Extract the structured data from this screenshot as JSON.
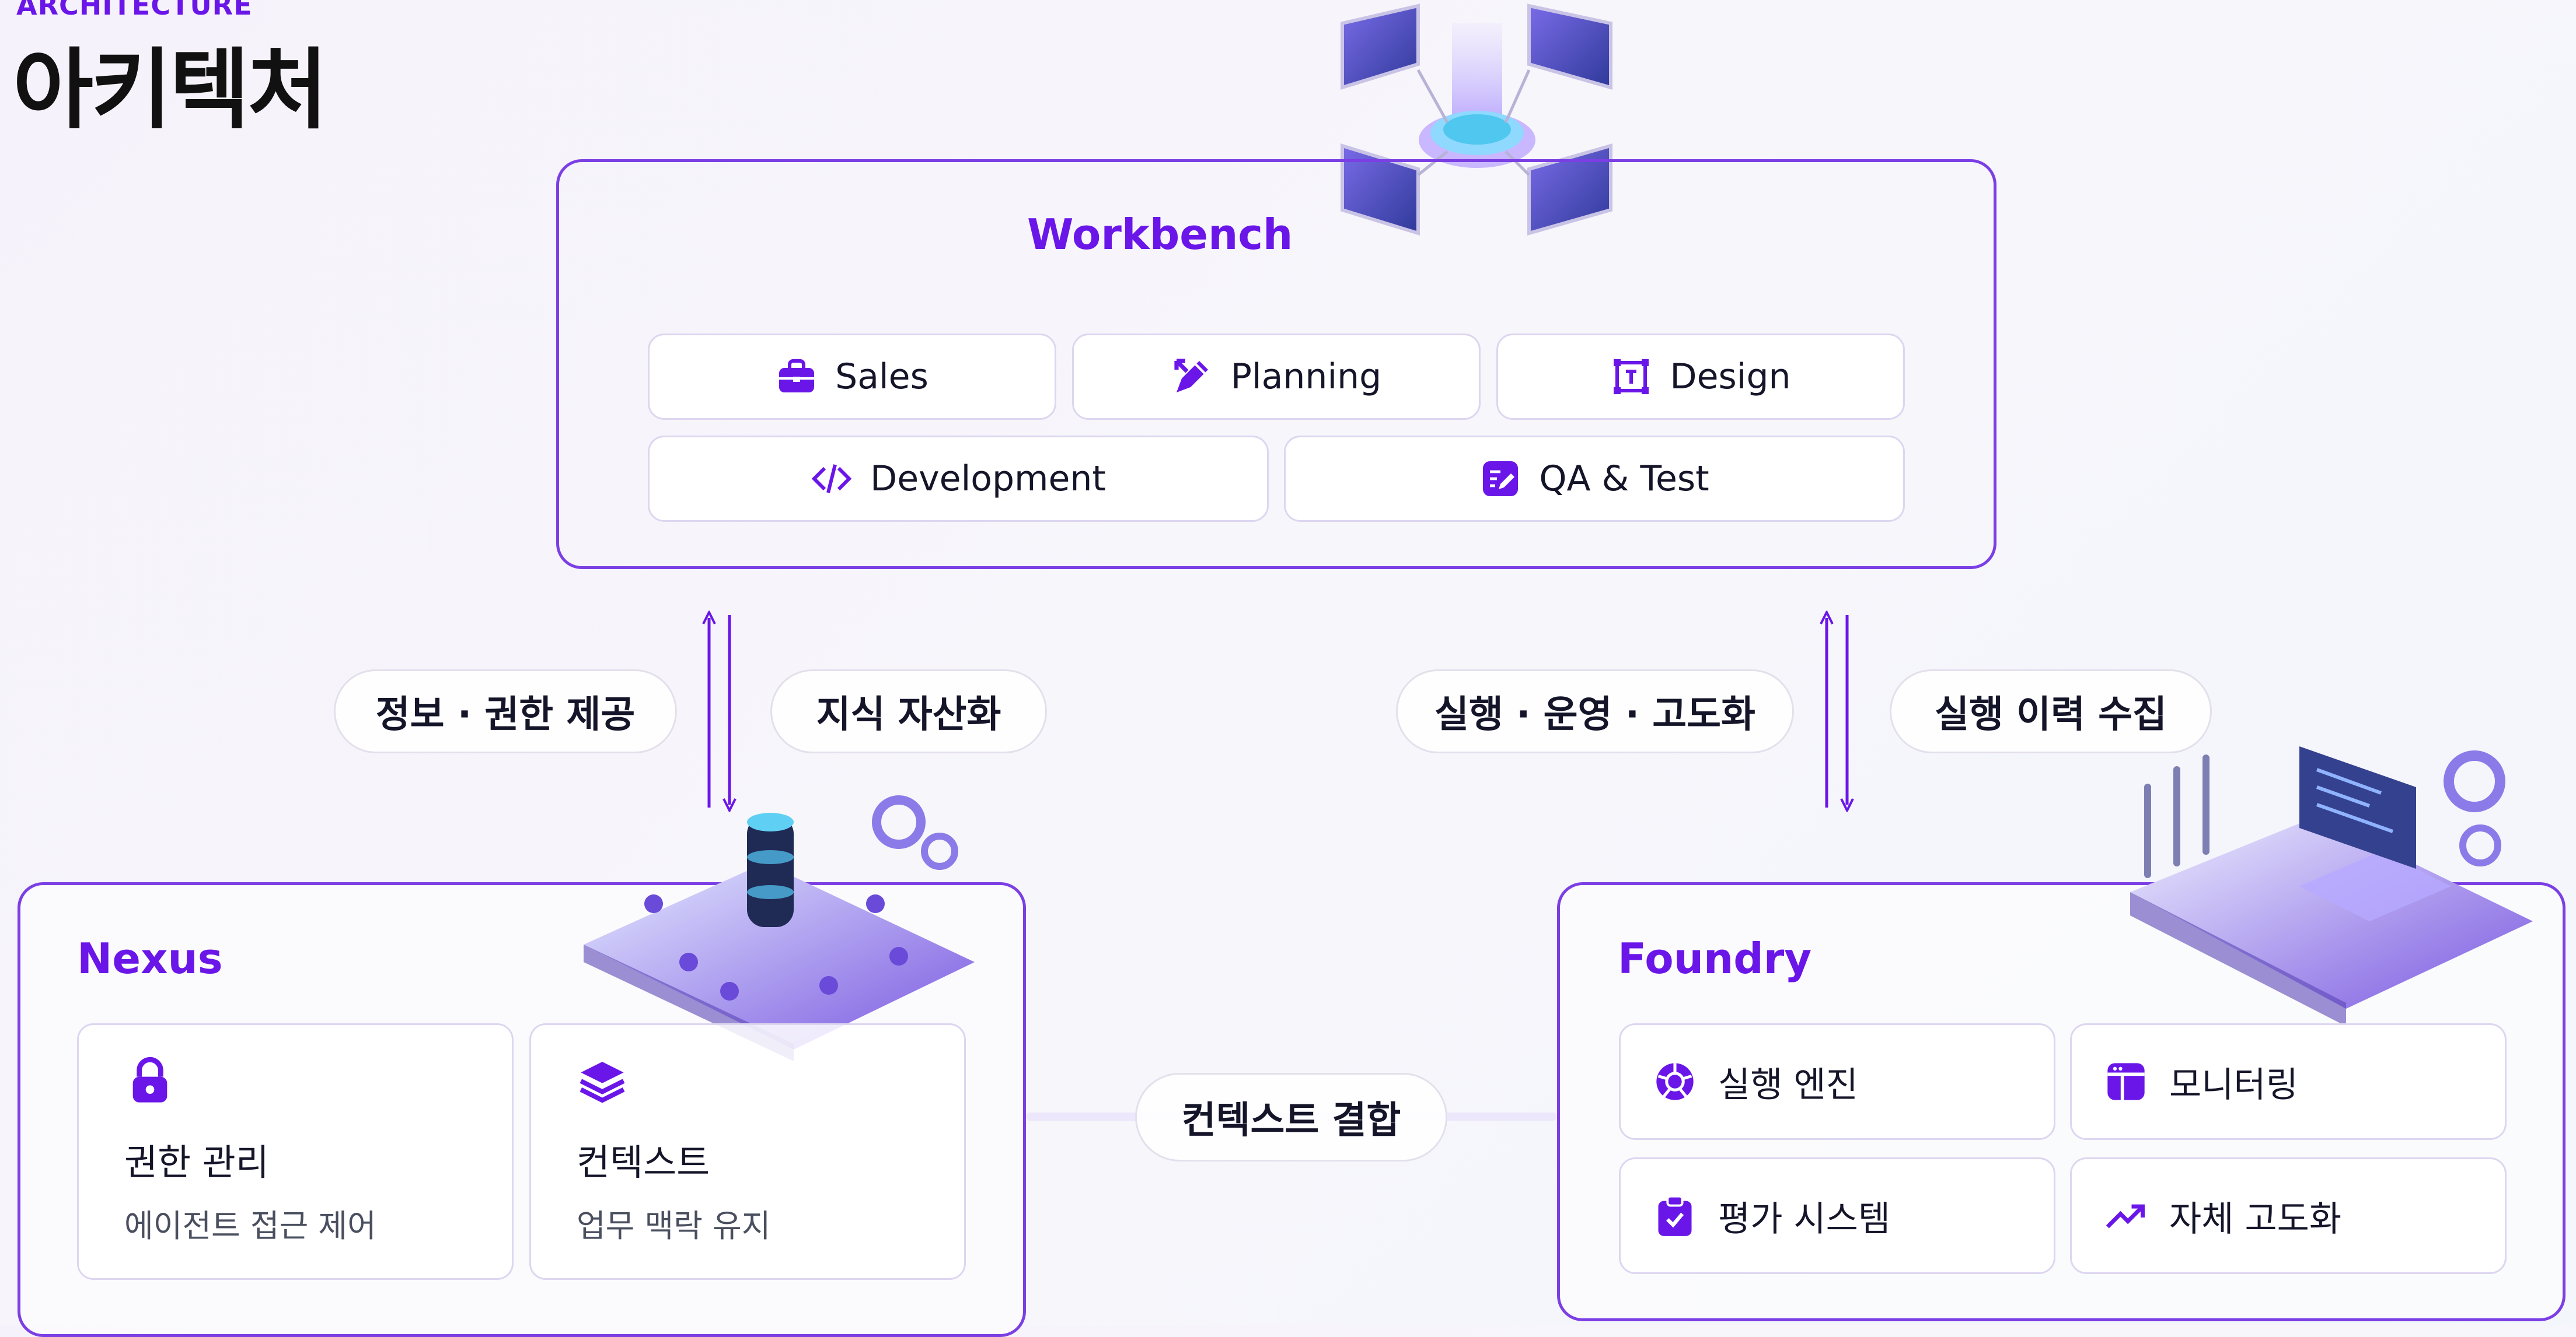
{
  "header": {
    "eyebrow": "ARCHITECTURE",
    "title": "아키텍처"
  },
  "workbench": {
    "title": "Workbench",
    "modules": [
      {
        "label": "Sales",
        "icon": "briefcase-icon"
      },
      {
        "label": "Planning",
        "icon": "pencil-ruler-icon"
      },
      {
        "label": "Design",
        "icon": "text-frame-icon"
      },
      {
        "label": "Development",
        "icon": "code-icon"
      },
      {
        "label": "QA & Test",
        "icon": "edit-checklist-icon"
      }
    ]
  },
  "nexus": {
    "title": "Nexus",
    "cards": [
      {
        "title": "권한 관리",
        "subtitle": "에이전트 접근 제어",
        "icon": "lock-icon"
      },
      {
        "title": "컨텍스트",
        "subtitle": "업무 맥락 유지",
        "icon": "layers-icon"
      }
    ]
  },
  "foundry": {
    "title": "Foundry",
    "items": [
      {
        "label": "실행 엔진",
        "icon": "aperture-icon"
      },
      {
        "label": "모니터링",
        "icon": "dashboard-window-icon"
      },
      {
        "label": "평가 시스템",
        "icon": "clipboard-check-icon"
      },
      {
        "label": "자체 고도화",
        "icon": "trending-up-icon"
      }
    ]
  },
  "connections": {
    "nexus_up": "정보 · 권한 제공",
    "nexus_down": "지식 자산화",
    "foundry_up": "실행 · 운영 · 고도화",
    "foundry_down": "실행 이력 수집",
    "context_link": "컨텍스트 결합"
  },
  "colors": {
    "accent": "#6a16e8",
    "border": "#7b3fe4",
    "chip_border": "#ddd6f0"
  }
}
